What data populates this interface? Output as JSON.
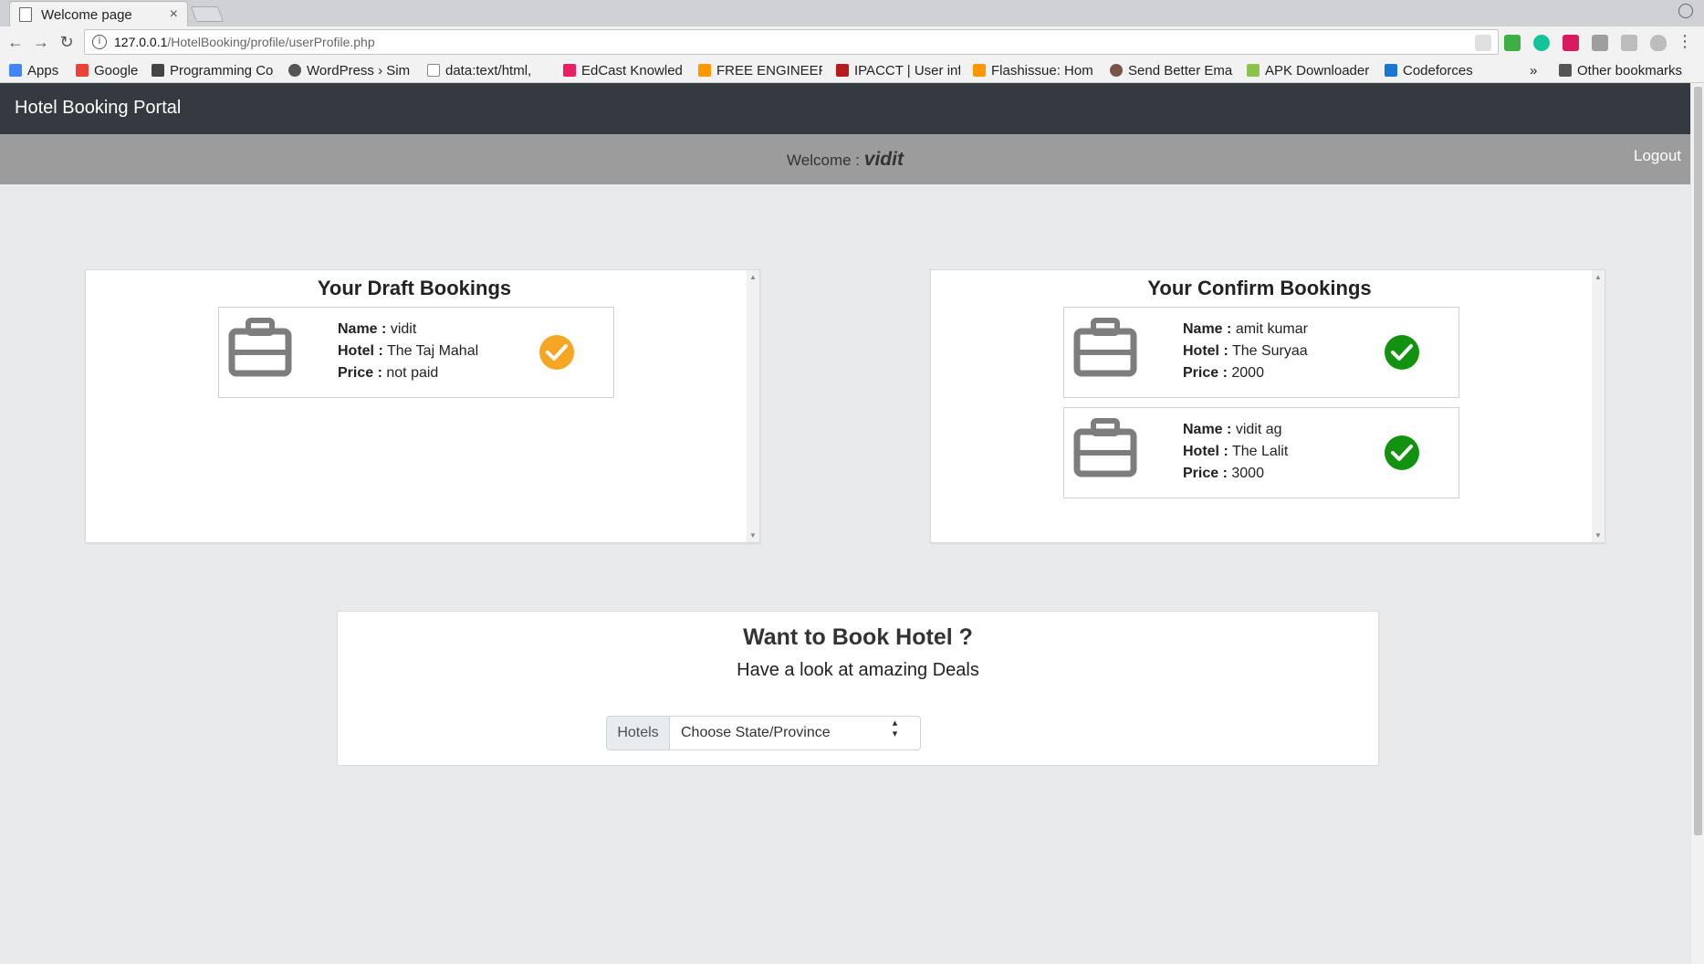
{
  "browser": {
    "tab_title": "Welcome page",
    "tab_close": "×",
    "url_host": "127.0.0.1",
    "url_path": "/HotelBooking/profile/userProfile.php",
    "bookmarks": [
      {
        "label": "Apps",
        "color": "#4285f4"
      },
      {
        "label": "Google",
        "color": "#ea4335"
      },
      {
        "label": "Programming Co",
        "color": "#444444"
      },
      {
        "label": "WordPress › Sim",
        "color": "#555555"
      },
      {
        "label": "data:text/html,",
        "color": "#888888"
      },
      {
        "label": "EdCast Knowled",
        "color": "#e91e63"
      },
      {
        "label": "FREE ENGINEERI",
        "color": "#ff9800"
      },
      {
        "label": "IPACCT | User inf",
        "color": "#b71c1c"
      },
      {
        "label": "Flashissue: Hom",
        "color": "#ff9800"
      },
      {
        "label": "Send Better Ema",
        "color": "#795548"
      },
      {
        "label": "APK Downloader",
        "color": "#8bc34a"
      },
      {
        "label": "Codeforces",
        "color": "#1976d2"
      }
    ],
    "overflow_label": "»",
    "other_bookmarks": "Other bookmarks"
  },
  "navbar": {
    "brand": "Hotel Booking Portal"
  },
  "welcome_bar": {
    "prefix": "Welcome : ",
    "username": "vidit",
    "logout": "Logout"
  },
  "draft": {
    "title": "Your Draft Bookings",
    "bookings": [
      {
        "name": "vidit",
        "hotel": "The Taj Mahal",
        "price": "not paid",
        "status_color": "#f5a623"
      }
    ]
  },
  "confirm": {
    "title": "Your Confirm Bookings",
    "bookings": [
      {
        "name": "amit kumar",
        "hotel": "The Suryaa",
        "price": "2000",
        "status_color": "#12930f"
      },
      {
        "name": "vidit ag",
        "hotel": "The Lalit",
        "price": "3000",
        "status_color": "#12930f"
      }
    ]
  },
  "labels": {
    "name": "Name :",
    "hotel": "Hotel :",
    "price": "Price :"
  },
  "book": {
    "title": "Want to Book Hotel ?",
    "subtitle": "Have a look at amazing Deals",
    "addon": "Hotels",
    "select_value": "Choose State/Province"
  }
}
